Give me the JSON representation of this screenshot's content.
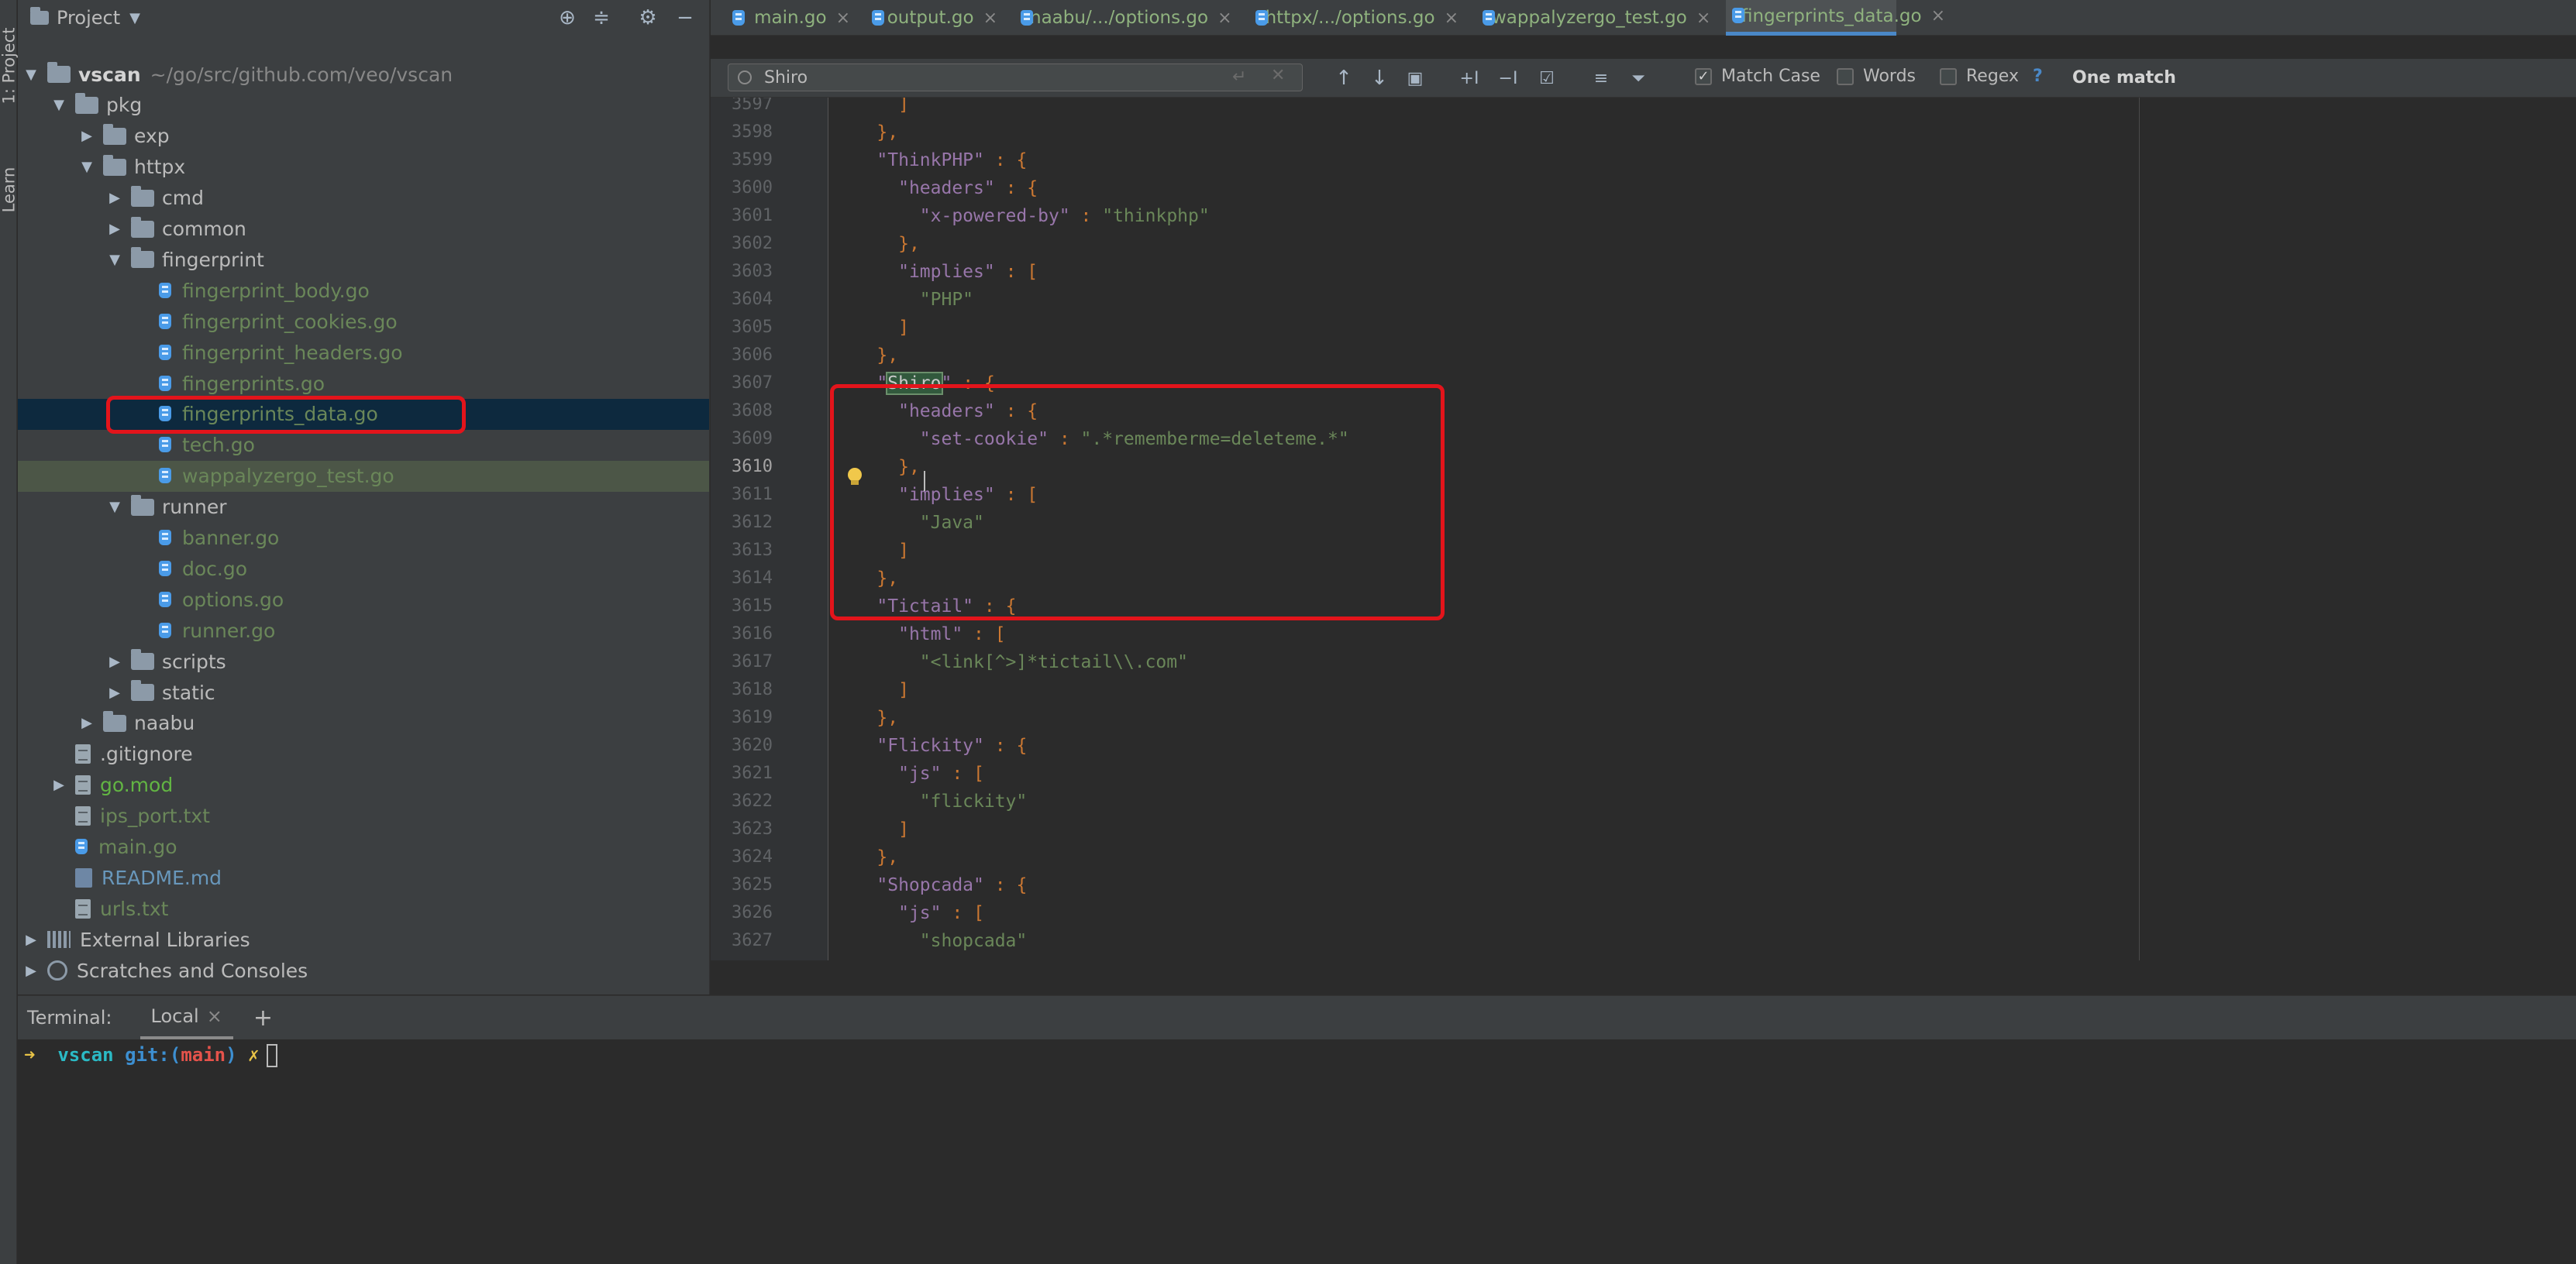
{
  "left_strip": {
    "project_tab": "1: Project",
    "learn_tab": "Learn"
  },
  "project_panel": {
    "title": "Project",
    "tree": [
      {
        "label": "vscan",
        "path": "~/go/src/github.com/veo/vscan",
        "type": "folder",
        "expanded": true,
        "bold": true
      },
      {
        "label": "pkg",
        "type": "folder",
        "expanded": true
      },
      {
        "label": "exp",
        "type": "folder",
        "expanded": false
      },
      {
        "label": "httpx",
        "type": "folder",
        "expanded": true
      },
      {
        "label": "cmd",
        "type": "folder",
        "expanded": false
      },
      {
        "label": "common",
        "type": "folder",
        "expanded": false
      },
      {
        "label": "fingerprint",
        "type": "folder",
        "expanded": true
      },
      {
        "label": "fingerprint_body.go",
        "type": "go"
      },
      {
        "label": "fingerprint_cookies.go",
        "type": "go"
      },
      {
        "label": "fingerprint_headers.go",
        "type": "go"
      },
      {
        "label": "fingerprints.go",
        "type": "go"
      },
      {
        "label": "fingerprints_data.go",
        "type": "go",
        "selected": true
      },
      {
        "label": "tech.go",
        "type": "go"
      },
      {
        "label": "wappalyzergo_test.go",
        "type": "go"
      },
      {
        "label": "runner",
        "type": "folder",
        "expanded": true
      },
      {
        "label": "banner.go",
        "type": "go"
      },
      {
        "label": "doc.go",
        "type": "go"
      },
      {
        "label": "options.go",
        "type": "go"
      },
      {
        "label": "runner.go",
        "type": "go"
      },
      {
        "label": "scripts",
        "type": "folder",
        "expanded": false
      },
      {
        "label": "static",
        "type": "folder",
        "expanded": false
      },
      {
        "label": "naabu",
        "type": "folder",
        "expanded": false
      },
      {
        "label": ".gitignore",
        "type": "file"
      },
      {
        "label": "go.mod",
        "type": "file"
      },
      {
        "label": "ips_port.txt",
        "type": "file"
      },
      {
        "label": "main.go",
        "type": "go"
      },
      {
        "label": "README.md",
        "type": "md"
      },
      {
        "label": "urls.txt",
        "type": "file"
      },
      {
        "label": "External Libraries",
        "type": "lib"
      },
      {
        "label": "Scratches and Consoles",
        "type": "scratch"
      }
    ]
  },
  "tabs": [
    {
      "label": "main.go"
    },
    {
      "label": "output.go"
    },
    {
      "label": "naabu/.../options.go"
    },
    {
      "label": "httpx/.../options.go"
    },
    {
      "label": "wappalyzergo_test.go"
    },
    {
      "label": "fingerprints_data.go",
      "active": true
    }
  ],
  "find_bar": {
    "query": "Shiro",
    "match_case_label": "Match Case",
    "match_case_checked": true,
    "words_label": "Words",
    "words_checked": false,
    "regex_label": "Regex",
    "regex_checked": false,
    "help": "?",
    "result": "One match"
  },
  "editor": {
    "current_line": "3610",
    "lines": [
      {
        "n": "3597",
        "text": "  ]"
      },
      {
        "n": "3598",
        "text": "},"
      },
      {
        "n": "3599",
        "text": "\"ThinkPHP\" : {"
      },
      {
        "n": "3600",
        "text": "  \"headers\" : {"
      },
      {
        "n": "3601",
        "text": "    \"x-powered-by\" : \"thinkphp\""
      },
      {
        "n": "3602",
        "text": "  },"
      },
      {
        "n": "3603",
        "text": "  \"implies\" : ["
      },
      {
        "n": "3604",
        "text": "    \"PHP\""
      },
      {
        "n": "3605",
        "text": "  ]"
      },
      {
        "n": "3606",
        "text": "},"
      },
      {
        "n": "3607",
        "text": "\"Shiro\" : {"
      },
      {
        "n": "3608",
        "text": "  \"headers\" : {"
      },
      {
        "n": "3609",
        "text": "    \"set-cookie\" : \".*rememberme=deleteme.*\""
      },
      {
        "n": "3610",
        "text": "  },"
      },
      {
        "n": "3611",
        "text": "  \"implies\" : ["
      },
      {
        "n": "3612",
        "text": "    \"Java\""
      },
      {
        "n": "3613",
        "text": "  ]"
      },
      {
        "n": "3614",
        "text": "},"
      },
      {
        "n": "3615",
        "text": "\"Tictail\" : {"
      },
      {
        "n": "3616",
        "text": "  \"html\" : ["
      },
      {
        "n": "3617",
        "text": "    \"<link[^>]*tictail\\\\.com\""
      },
      {
        "n": "3618",
        "text": "  ]"
      },
      {
        "n": "3619",
        "text": "},"
      },
      {
        "n": "3620",
        "text": "\"Flickity\" : {"
      },
      {
        "n": "3621",
        "text": "  \"js\" : ["
      },
      {
        "n": "3622",
        "text": "    \"flickity\""
      },
      {
        "n": "3623",
        "text": "  ]"
      },
      {
        "n": "3624",
        "text": "},"
      },
      {
        "n": "3625",
        "text": "\"Shopcada\" : {"
      },
      {
        "n": "3626",
        "text": "  \"js\" : ["
      },
      {
        "n": "3627",
        "text": "    \"shopcada\""
      }
    ]
  },
  "terminal": {
    "label": "Terminal:",
    "tab": "Local",
    "prompt_arrow": "➜",
    "dir": "vscan",
    "git_prefix": "git:(",
    "branch": "main",
    "git_suffix": ")",
    "dirty_mark": "✗"
  },
  "colors": {
    "annotation": "#e3141b",
    "selection": "#0d293e",
    "accent": "#4a88c7"
  }
}
